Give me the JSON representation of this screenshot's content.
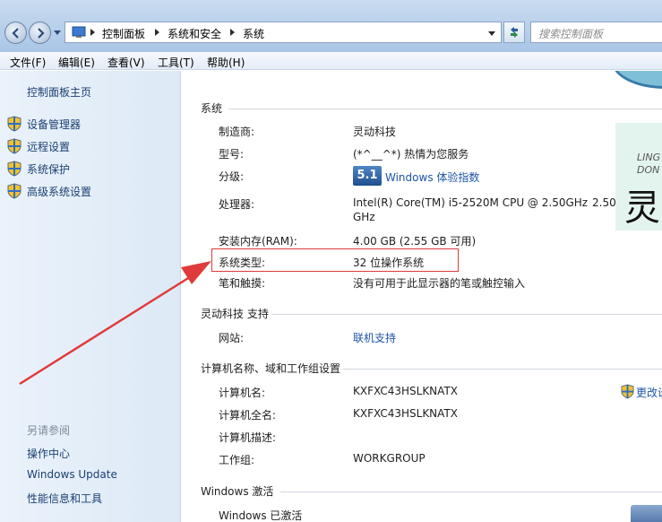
{
  "window": {
    "breadcrumbs": [
      "控制面板",
      "系统和安全",
      "系统"
    ],
    "search_placeholder": "搜索控制面板"
  },
  "menu": [
    "文件(F)",
    "编辑(E)",
    "查看(V)",
    "工具(T)",
    "帮助(H)"
  ],
  "left_pane": {
    "home": "控制面板主页",
    "links": [
      "设备管理器",
      "远程设置",
      "系统保护",
      "高级系统设置"
    ],
    "see_also_title": "另请参阅",
    "see_also": [
      "操作中心",
      "Windows Update",
      "性能信息和工具"
    ]
  },
  "system": {
    "title": "系统",
    "rows": [
      {
        "label": "制造商:",
        "value": "灵动科技"
      },
      {
        "label": "型号:",
        "value": "(*^__^*) 热情为您服务"
      },
      {
        "label": "分级:",
        "value": ""
      },
      {
        "label": "处理器:",
        "value": "Intel(R) Core(TM) i5-2520M CPU @ 2.50GHz"
      },
      {
        "label": "安装内存(RAM):",
        "value": "4.00 GB (2.55 GB 可用)"
      },
      {
        "label": "系统类型:",
        "value": "32 位操作系统"
      },
      {
        "label": "笔和触摸:",
        "value": "没有可用于此显示器的笔或触控输入"
      }
    ],
    "wei_score": "5.1",
    "wei_label": "Windows 体验指数",
    "cpu_extra": "2.50",
    "cpu_line2": "GHz"
  },
  "oem_logo": {
    "line1": "LING",
    "line2": "DON",
    "glyph": "灵"
  },
  "support": {
    "title": "灵动科技 支持",
    "rows": [
      {
        "label": "网站:",
        "value": "联机支持"
      }
    ]
  },
  "computer": {
    "title": "计算机名称、域和工作组设置",
    "rows": [
      {
        "label": "计算机名:",
        "value": "KXFXC43HSLKNATX"
      },
      {
        "label": "计算机全名:",
        "value": "KXFXC43HSLKNATX"
      },
      {
        "label": "计算机描述:",
        "value": ""
      },
      {
        "label": "工作组:",
        "value": "WORKGROUP"
      }
    ],
    "change_link": "更改设"
  },
  "activation": {
    "title": "Windows 激活",
    "status": "Windows 已激活"
  },
  "colors": {
    "annotation": "#e03a3a",
    "link": "#1c55a8"
  }
}
